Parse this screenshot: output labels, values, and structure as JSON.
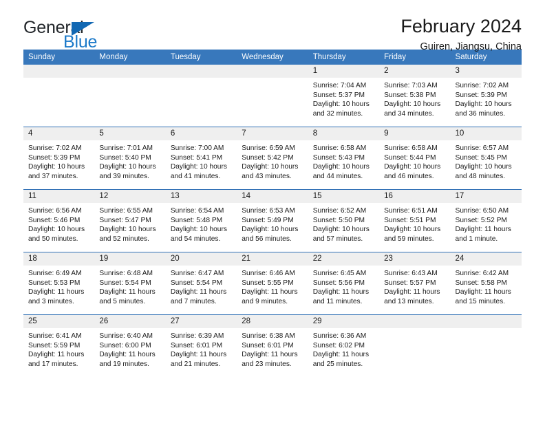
{
  "brand": {
    "name_part1": "General",
    "name_part2": "Blue",
    "triangle_color": "#1268b3",
    "blue_color": "#1b79c9"
  },
  "header": {
    "title": "February 2024",
    "subtitle": "Guiren, Jiangsu, China"
  },
  "theme": {
    "header_bg": "#3878bc",
    "row_divider": "#2f6fb5",
    "daynum_bg": "#efefef"
  },
  "weekdays": [
    "Sunday",
    "Monday",
    "Tuesday",
    "Wednesday",
    "Thursday",
    "Friday",
    "Saturday"
  ],
  "weeks": [
    [
      {
        "day": "",
        "empty": true
      },
      {
        "day": "",
        "empty": true
      },
      {
        "day": "",
        "empty": true
      },
      {
        "day": "",
        "empty": true
      },
      {
        "day": "1",
        "sunrise": "Sunrise: 7:04 AM",
        "sunset": "Sunset: 5:37 PM",
        "daylight": "Daylight: 10 hours and 32 minutes."
      },
      {
        "day": "2",
        "sunrise": "Sunrise: 7:03 AM",
        "sunset": "Sunset: 5:38 PM",
        "daylight": "Daylight: 10 hours and 34 minutes."
      },
      {
        "day": "3",
        "sunrise": "Sunrise: 7:02 AM",
        "sunset": "Sunset: 5:39 PM",
        "daylight": "Daylight: 10 hours and 36 minutes."
      }
    ],
    [
      {
        "day": "4",
        "sunrise": "Sunrise: 7:02 AM",
        "sunset": "Sunset: 5:39 PM",
        "daylight": "Daylight: 10 hours and 37 minutes."
      },
      {
        "day": "5",
        "sunrise": "Sunrise: 7:01 AM",
        "sunset": "Sunset: 5:40 PM",
        "daylight": "Daylight: 10 hours and 39 minutes."
      },
      {
        "day": "6",
        "sunrise": "Sunrise: 7:00 AM",
        "sunset": "Sunset: 5:41 PM",
        "daylight": "Daylight: 10 hours and 41 minutes."
      },
      {
        "day": "7",
        "sunrise": "Sunrise: 6:59 AM",
        "sunset": "Sunset: 5:42 PM",
        "daylight": "Daylight: 10 hours and 43 minutes."
      },
      {
        "day": "8",
        "sunrise": "Sunrise: 6:58 AM",
        "sunset": "Sunset: 5:43 PM",
        "daylight": "Daylight: 10 hours and 44 minutes."
      },
      {
        "day": "9",
        "sunrise": "Sunrise: 6:58 AM",
        "sunset": "Sunset: 5:44 PM",
        "daylight": "Daylight: 10 hours and 46 minutes."
      },
      {
        "day": "10",
        "sunrise": "Sunrise: 6:57 AM",
        "sunset": "Sunset: 5:45 PM",
        "daylight": "Daylight: 10 hours and 48 minutes."
      }
    ],
    [
      {
        "day": "11",
        "sunrise": "Sunrise: 6:56 AM",
        "sunset": "Sunset: 5:46 PM",
        "daylight": "Daylight: 10 hours and 50 minutes."
      },
      {
        "day": "12",
        "sunrise": "Sunrise: 6:55 AM",
        "sunset": "Sunset: 5:47 PM",
        "daylight": "Daylight: 10 hours and 52 minutes."
      },
      {
        "day": "13",
        "sunrise": "Sunrise: 6:54 AM",
        "sunset": "Sunset: 5:48 PM",
        "daylight": "Daylight: 10 hours and 54 minutes."
      },
      {
        "day": "14",
        "sunrise": "Sunrise: 6:53 AM",
        "sunset": "Sunset: 5:49 PM",
        "daylight": "Daylight: 10 hours and 56 minutes."
      },
      {
        "day": "15",
        "sunrise": "Sunrise: 6:52 AM",
        "sunset": "Sunset: 5:50 PM",
        "daylight": "Daylight: 10 hours and 57 minutes."
      },
      {
        "day": "16",
        "sunrise": "Sunrise: 6:51 AM",
        "sunset": "Sunset: 5:51 PM",
        "daylight": "Daylight: 10 hours and 59 minutes."
      },
      {
        "day": "17",
        "sunrise": "Sunrise: 6:50 AM",
        "sunset": "Sunset: 5:52 PM",
        "daylight": "Daylight: 11 hours and 1 minute."
      }
    ],
    [
      {
        "day": "18",
        "sunrise": "Sunrise: 6:49 AM",
        "sunset": "Sunset: 5:53 PM",
        "daylight": "Daylight: 11 hours and 3 minutes."
      },
      {
        "day": "19",
        "sunrise": "Sunrise: 6:48 AM",
        "sunset": "Sunset: 5:54 PM",
        "daylight": "Daylight: 11 hours and 5 minutes."
      },
      {
        "day": "20",
        "sunrise": "Sunrise: 6:47 AM",
        "sunset": "Sunset: 5:54 PM",
        "daylight": "Daylight: 11 hours and 7 minutes."
      },
      {
        "day": "21",
        "sunrise": "Sunrise: 6:46 AM",
        "sunset": "Sunset: 5:55 PM",
        "daylight": "Daylight: 11 hours and 9 minutes."
      },
      {
        "day": "22",
        "sunrise": "Sunrise: 6:45 AM",
        "sunset": "Sunset: 5:56 PM",
        "daylight": "Daylight: 11 hours and 11 minutes."
      },
      {
        "day": "23",
        "sunrise": "Sunrise: 6:43 AM",
        "sunset": "Sunset: 5:57 PM",
        "daylight": "Daylight: 11 hours and 13 minutes."
      },
      {
        "day": "24",
        "sunrise": "Sunrise: 6:42 AM",
        "sunset": "Sunset: 5:58 PM",
        "daylight": "Daylight: 11 hours and 15 minutes."
      }
    ],
    [
      {
        "day": "25",
        "sunrise": "Sunrise: 6:41 AM",
        "sunset": "Sunset: 5:59 PM",
        "daylight": "Daylight: 11 hours and 17 minutes."
      },
      {
        "day": "26",
        "sunrise": "Sunrise: 6:40 AM",
        "sunset": "Sunset: 6:00 PM",
        "daylight": "Daylight: 11 hours and 19 minutes."
      },
      {
        "day": "27",
        "sunrise": "Sunrise: 6:39 AM",
        "sunset": "Sunset: 6:01 PM",
        "daylight": "Daylight: 11 hours and 21 minutes."
      },
      {
        "day": "28",
        "sunrise": "Sunrise: 6:38 AM",
        "sunset": "Sunset: 6:01 PM",
        "daylight": "Daylight: 11 hours and 23 minutes."
      },
      {
        "day": "29",
        "sunrise": "Sunrise: 6:36 AM",
        "sunset": "Sunset: 6:02 PM",
        "daylight": "Daylight: 11 hours and 25 minutes."
      },
      {
        "day": "",
        "empty": true
      },
      {
        "day": "",
        "empty": true
      }
    ]
  ]
}
